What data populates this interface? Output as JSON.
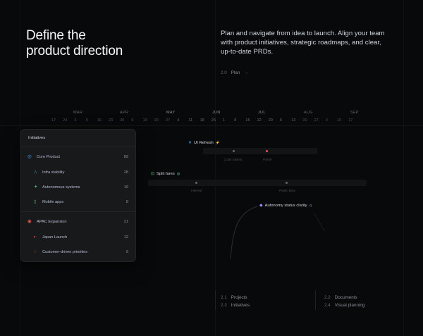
{
  "header": {
    "title_line1": "Define the",
    "title_line2": "product direction",
    "description": "Plan and navigate from idea to launch. Align your team with product initiatives, strategic roadmaps, and clear, up-to-date PRDs.",
    "crumb_num": "2.0",
    "crumb_label": "Plan",
    "crumb_arrow": "→"
  },
  "timeline": {
    "months": [
      "MAR",
      "APR",
      "MAY",
      "JUN",
      "JUL",
      "AUG",
      "SEP"
    ],
    "days": [
      "17",
      "24",
      "3",
      "9",
      "16",
      "23",
      "30",
      "6",
      "13",
      "20",
      "27",
      "4",
      "11",
      "18",
      "25",
      "1",
      "8",
      "15",
      "22",
      "29",
      "6",
      "13",
      "20",
      "27",
      "3",
      "10",
      "17"
    ],
    "projects": [
      {
        "name": "UI Refresh",
        "icon": "✕",
        "tag": "⚡",
        "m1": "Color tokens",
        "m2": "Polish"
      },
      {
        "name": "Split fares",
        "icon": "⊡",
        "tag": "◍",
        "m1": "Internal",
        "m2": "Public Beta"
      },
      {
        "name": "Autonomy status clarity",
        "icon": "◆",
        "tag": "◍"
      }
    ]
  },
  "initiatives": {
    "title": "Initiatives",
    "items": [
      {
        "name": "Core Product",
        "count": "89",
        "color": "#4ea7fc"
      },
      {
        "name": "Infra stability",
        "count": "28",
        "color": "#4ea7fc"
      },
      {
        "name": "Autonomous systems",
        "count": "16",
        "color": "#4cb782"
      },
      {
        "name": "Mobile apps",
        "count": "8",
        "color": "#4cb782"
      },
      {
        "name": "APAC Expansion",
        "count": "21",
        "color": "#eb5757"
      },
      {
        "name": "Japan Launch",
        "count": "12",
        "color": "#eb5757"
      },
      {
        "name": "Customer-driven priorities",
        "count": "9",
        "color": "#eb5757"
      }
    ]
  },
  "footer": {
    "links": [
      {
        "num": "2.1",
        "label": "Projects"
      },
      {
        "num": "2.3",
        "label": "Initiatives"
      },
      {
        "num": "2.2",
        "label": "Documents"
      },
      {
        "num": "2.4",
        "label": "Visual planning"
      }
    ]
  }
}
